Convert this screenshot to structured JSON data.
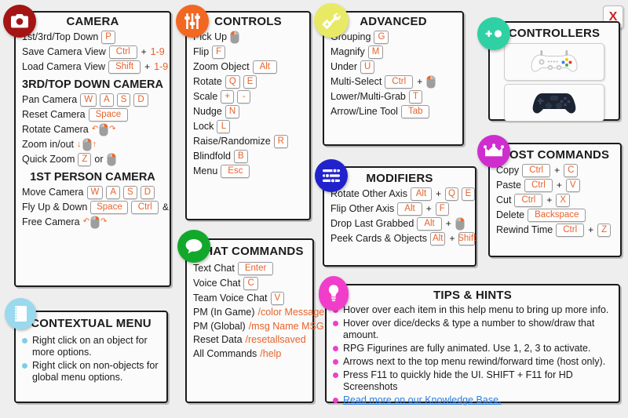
{
  "window": {
    "close_label": "X",
    "background": "#eeeeee",
    "accent_orange": "#e8622a"
  },
  "panels": {
    "camera": {
      "title": "CAMERA",
      "icon": "camera-icon",
      "icon_color": "#a41414",
      "rows": [
        {
          "label": "1st/3rd/Top Down",
          "keys": [
            "P"
          ]
        },
        {
          "label": "Save Camera View",
          "keys": [
            "Ctrl"
          ],
          "plus": "+",
          "tail": "1-9"
        },
        {
          "label": "Load Camera View",
          "keys": [
            "Shift"
          ],
          "plus": "+",
          "tail": "1-9"
        }
      ],
      "sub1": "3RD/TOP DOWN CAMERA",
      "rows2": [
        {
          "label": "Pan Camera",
          "keys": [
            "W",
            "A",
            "S",
            "D"
          ]
        },
        {
          "label": "Reset Camera",
          "keys": [
            "Space"
          ]
        },
        {
          "label": "Rotate Camera",
          "mouse": "mouse-drag-right"
        },
        {
          "label": "Zoom in/out",
          "mouse": "mouse-scroll"
        },
        {
          "label": "Quick Zoom",
          "keys": [
            "Z"
          ],
          "or": "or",
          "mouse": "mouse-middle"
        }
      ],
      "sub2": "1ST PERSON CAMERA",
      "rows3": [
        {
          "label": "Move Camera",
          "keys": [
            "W",
            "A",
            "S",
            "D"
          ]
        },
        {
          "label": "Fly Up & Down",
          "keys": [
            "Space"
          ],
          "amp": "&",
          "keys2": [
            "Ctrl"
          ]
        },
        {
          "label": "Free Camera",
          "mouse": "mouse-drag-right"
        }
      ]
    },
    "contextual_menu": {
      "title": "CONTEXTUAL MENU",
      "icon": "notebook-icon",
      "icon_color": "#9ad9ee",
      "bullet_color": "#7fcde6",
      "bullets": [
        "Right click on an object for more options.",
        "Right click on non-objects for global menu options."
      ]
    },
    "controls": {
      "title": "CONTROLS",
      "icon": "sliders-icon",
      "icon_color": "#f26722",
      "rows": [
        {
          "label": "Pick Up",
          "mouse": "mouse-left"
        },
        {
          "label": "Flip",
          "keys": [
            "F"
          ]
        },
        {
          "label": "Zoom Object",
          "keys": [
            "Alt"
          ]
        },
        {
          "label": "Rotate",
          "keys": [
            "Q",
            "E"
          ]
        },
        {
          "label": "Scale",
          "keys": [
            "+",
            "-"
          ]
        },
        {
          "label": "Nudge",
          "keys": [
            "N"
          ]
        },
        {
          "label": "Lock",
          "keys": [
            "L"
          ]
        },
        {
          "label": "Raise/Randomize",
          "keys": [
            "R"
          ]
        },
        {
          "label": "Blindfold",
          "keys": [
            "B"
          ]
        },
        {
          "label": "Menu",
          "keys": [
            "Esc"
          ]
        }
      ]
    },
    "chat_commands": {
      "title": "CHAT COMMANDS",
      "icon": "speech-bubble-icon",
      "icon_color": "#12a82b",
      "rows": [
        {
          "label": "Text Chat",
          "keys": [
            "Enter"
          ]
        },
        {
          "label": "Voice Chat",
          "keys": [
            "C"
          ]
        },
        {
          "label": "Team Voice Chat",
          "keys": [
            "V"
          ]
        },
        {
          "label": "PM (In Game)",
          "cmd": "/color Message"
        },
        {
          "label": "PM (Global)",
          "cmd": "/msg Name MSG"
        },
        {
          "label": "Reset Data",
          "cmd": "/resetallsaved"
        },
        {
          "label": "All Commands",
          "cmd": "/help"
        }
      ]
    },
    "advanced": {
      "title": "ADVANCED",
      "icon": "wrench-gear-icon",
      "icon_color": "#e8ea66",
      "rows": [
        {
          "label": "Grouping",
          "keys": [
            "G"
          ]
        },
        {
          "label": "Magnify",
          "keys": [
            "M"
          ]
        },
        {
          "label": "Under",
          "keys": [
            "U"
          ]
        },
        {
          "label": "Multi-Select",
          "keys": [
            "Ctrl"
          ],
          "plus": "+",
          "mouse": "mouse-left"
        },
        {
          "label": "Lower/Multi-Grab",
          "keys": [
            "T"
          ]
        },
        {
          "label": "Arrow/Line Tool",
          "keys": [
            "Tab"
          ]
        }
      ]
    },
    "modifiers": {
      "title": "MODIFIERS",
      "icon": "equalizer-icon",
      "icon_color": "#2222cc",
      "rows": [
        {
          "label": "Rotate Other Axis",
          "keys": [
            "Alt"
          ],
          "plus": "+",
          "keys2": [
            "Q",
            "E"
          ]
        },
        {
          "label": "Flip Other Axis",
          "keys": [
            "Alt"
          ],
          "plus": "+",
          "keys2": [
            "F"
          ]
        },
        {
          "label": "Drop Last Grabbed",
          "keys": [
            "Alt"
          ],
          "plus": "+",
          "mouse": "mouse-right"
        },
        {
          "label": "Peek Cards & Objects",
          "keys": [
            "Alt"
          ],
          "plus": "+",
          "keys2": [
            "Shift"
          ]
        }
      ]
    },
    "controllers": {
      "title": "CONTROLLERS",
      "icon": "gamepad-icon",
      "icon_color": "#2fd0a4",
      "tiles": [
        {
          "name": "xbox-controller",
          "label": "Xbox Controller"
        },
        {
          "name": "playstation-controller",
          "label": "PlayStation Controller"
        }
      ]
    },
    "host_commands": {
      "title": "HOST COMMANDS",
      "icon": "crown-icon",
      "icon_color": "#cf2ecf",
      "rows": [
        {
          "label": "Copy",
          "keys": [
            "Ctrl"
          ],
          "plus": "+",
          "keys2": [
            "C"
          ]
        },
        {
          "label": "Paste",
          "keys": [
            "Ctrl"
          ],
          "plus": "+",
          "keys2": [
            "V"
          ]
        },
        {
          "label": "Cut",
          "keys": [
            "Ctrl"
          ],
          "plus": "+",
          "keys2": [
            "X"
          ]
        },
        {
          "label": "Delete",
          "keys": [
            "Backspace"
          ]
        },
        {
          "label": "Rewind Time",
          "keys": [
            "Ctrl"
          ],
          "plus": "+",
          "keys2": [
            "Z"
          ]
        }
      ]
    },
    "tips": {
      "title": "TIPS & HINTS",
      "icon": "lightbulb-icon",
      "icon_color": "#f03ecb",
      "bullet_color": "#f03ecb",
      "bullets": [
        "Hover over each item in this help menu to bring up more info.",
        "Hover over dice/decks & type a number to show/draw that amount.",
        "RPG Figurines are fully animated. Use 1, 2, 3 to activate.",
        "Arrows next to the top menu rewind/forward time (host only).",
        "Press F11 to quickly hide the UI. SHIFT + F11 for HD Screenshots"
      ],
      "link": "Read more on our Knowledge Base."
    }
  }
}
